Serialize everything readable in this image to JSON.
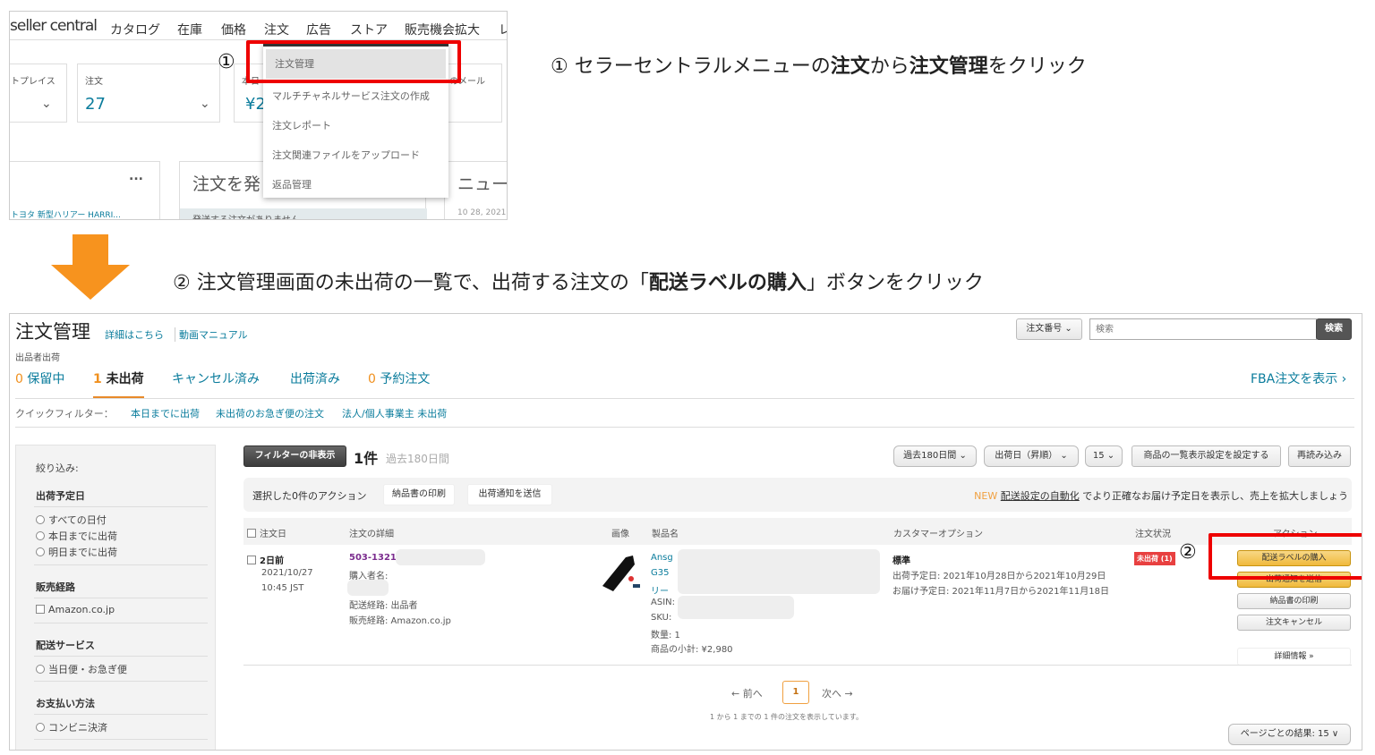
{
  "step1": {
    "caption": {
      "num": "①",
      "pre": " セラーセントラルメニューの",
      "b1": "注文",
      "mid": "から",
      "b2": "注文管理",
      "post": "をクリック"
    },
    "logo": "seller central",
    "nav": [
      "カタログ",
      "在庫",
      "価格",
      "注文",
      "広告",
      "ストア",
      "販売機会拡大",
      "レ"
    ],
    "cards": {
      "marketplace_label": "トプレイス",
      "orders_label": "注文",
      "orders_value": "27",
      "sales_label": "本日",
      "sales_value": "¥2",
      "mail_label": "のメール"
    },
    "dropdown": [
      "注文管理",
      "マルチチャネルサービス注文の作成",
      "注文レポート",
      "注文関連ファイルをアップロード",
      "返品管理"
    ],
    "marker": "①",
    "lower": {
      "more": "...",
      "card1_text": "トヨタ 新型ハリアー HARRI...",
      "card2_title": "注文を発",
      "card2_sub": "発送する注文がありません",
      "card3_title": "ニュー",
      "card3_date": "10 28, 2021"
    }
  },
  "step2": {
    "caption": {
      "num": "②",
      "pre": " 注文管理画面の未出荷の一覧で、出荷する注文の「",
      "b": "配送ラベルの購入",
      "post": "」ボタンをクリック"
    },
    "arrow_color": "#f7931e",
    "title": "注文管理",
    "help_link": "詳細はこちら",
    "video_link": "動画マニュアル",
    "search": {
      "select": "注文番号",
      "placeholder": "検索",
      "button": "検索"
    },
    "subtitle": "出品者出荷",
    "tabs": [
      {
        "count": "0",
        "label": "保留中"
      },
      {
        "count": "1",
        "label": "未出荷",
        "active": true
      },
      {
        "count": "",
        "label": "キャンセル済み"
      },
      {
        "count": "",
        "label": "出荷済み"
      },
      {
        "count": "0",
        "label": "予約注文"
      }
    ],
    "fba_link": "FBA注文を表示 ›",
    "quick_filter": {
      "label": "クイックフィルター：",
      "items": [
        "本日までに出荷",
        "未出荷のお急ぎ便の注文",
        "法人/個人事業主 未出荷"
      ]
    },
    "sidebar": {
      "title": "絞り込み:",
      "groups": [
        {
          "heading": "出荷予定日",
          "type": "radio",
          "items": [
            "すべての日付",
            "本日までに出荷",
            "明日までに出荷"
          ]
        },
        {
          "heading": "販売経路",
          "type": "checkbox",
          "items": [
            "Amazon.co.jp"
          ]
        },
        {
          "heading": "配送サービス",
          "type": "radio",
          "items": [
            "当日便・お急ぎ便"
          ]
        },
        {
          "heading": "お支払い方法",
          "type": "radio",
          "items": [
            "コンビニ決済"
          ]
        }
      ]
    },
    "toolbar": {
      "hide_filter": "フィルターの非表示",
      "count": "1件",
      "period": "過去180日間",
      "range_select": "過去180日間",
      "sort_select": "出荷日（昇順）",
      "per_select": "15",
      "settings": "商品の一覧表示設定を設定する",
      "reload": "再読み込み"
    },
    "bulk": {
      "label": "選択した0件のアクション",
      "print": "納品書の印刷",
      "notify": "出荷通知を送信",
      "new": "NEW",
      "auto_link": "配送設定の自動化",
      "promo": " でより正確なお届け予定日を表示し、売上を拡大しましょう"
    },
    "columns": [
      "注文日",
      "注文の詳細",
      "画像",
      "製品名",
      "カスタマーオプション",
      "注文状況",
      "アクション"
    ],
    "order": {
      "age": "2日前",
      "date": "2021/10/27",
      "time": "10:45 JST",
      "id": "503-1321",
      "buyer": "購入者名:",
      "route": "配送経路: 出品者",
      "channel": "販売経路: Amazon.co.jp",
      "product_l1": "Ansg",
      "product_l2": "G35",
      "product_l3": "リー",
      "asin": "ASIN:",
      "sku": "SKU:",
      "qty": "数量: 1",
      "subtotal": "商品の小計: ¥2,980",
      "option": "標準",
      "ship_by": "出荷予定日: 2021年10月28日から2021年10月29日",
      "deliver_by": "お届け予定日: 2021年11月7日から2021年11月18日",
      "status": "未出荷 (1)",
      "marker": "②",
      "actions": [
        "配送ラベルの購入",
        "出荷通知を送信",
        "納品書の印刷",
        "注文キャンセル"
      ],
      "details": "詳細情報 »"
    },
    "pagination": {
      "prev": "← 前へ",
      "page": "1",
      "next": "次へ →",
      "summary": "1 から 1 までの 1 件の注文を表示しています。",
      "per_page": "ページごとの結果: 15 ∨"
    }
  }
}
